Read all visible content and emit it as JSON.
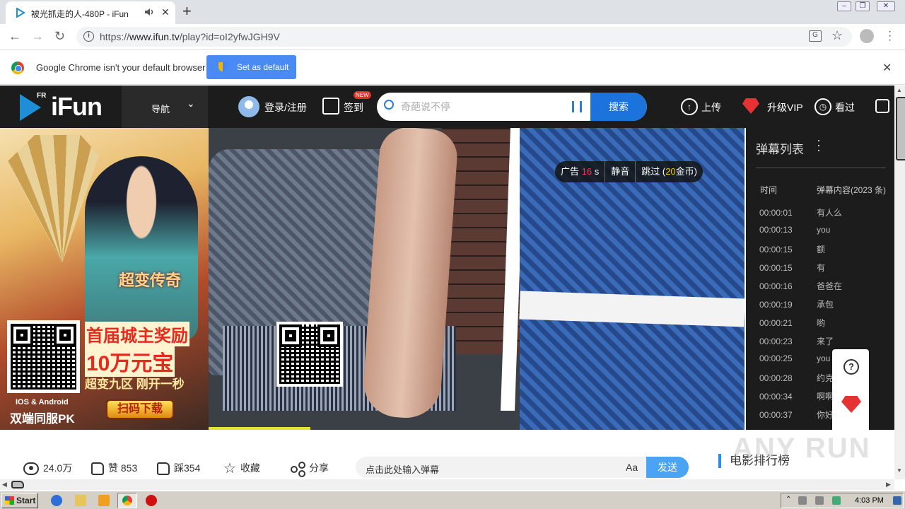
{
  "browser": {
    "tab_title": "被光抓走的人-480P - iFun",
    "new_tab": "+",
    "url_prefix": "https://",
    "url_host": "www.ifun.tv",
    "url_path": "/play?id=oI2yfwJGH9V",
    "infobar_message": "Google Chrome isn't your default browser",
    "set_default_label": "Set as default"
  },
  "site": {
    "logo_sup": "FR",
    "logo_text": "iFun",
    "nav_label": "导航",
    "login_label": "登录/注册",
    "signin_label": "签到",
    "signin_badge": "NEW",
    "search_placeholder": "奇葩说不停",
    "search_button": "搜索",
    "upload_label": "上传",
    "vip_label": "升级VIP",
    "history_label": "看过"
  },
  "ad": {
    "game_title": "超变传奇",
    "line1": "首届城主奖励",
    "line2": "10万元宝",
    "line3": "超变九区 刚开一秒",
    "platform": "IOS & Android",
    "pk": "双端同服PK",
    "download": "扫码下载"
  },
  "player": {
    "ad_prefix": "广告",
    "ad_seconds": "16",
    "ad_unit": "s",
    "mute_label": "静音",
    "skip_prefix": "跳过 (",
    "skip_coins": "20",
    "skip_suffix": "金币)",
    "progress_fraction": 0.19
  },
  "danmaku": {
    "title": "弹幕列表",
    "col_time": "时间",
    "col_content": "弹幕内容(2023 条)",
    "rows": [
      {
        "time": "00:00:01",
        "text": "有人么"
      },
      {
        "time": "00:00:13",
        "text": "you"
      },
      {
        "time": "00:00:15",
        "text": "额"
      },
      {
        "time": "00:00:15",
        "text": "有"
      },
      {
        "time": "00:00:16",
        "text": "爸爸在"
      },
      {
        "time": "00:00:19",
        "text": "承包"
      },
      {
        "time": "00:00:21",
        "text": "哟"
      },
      {
        "time": "00:00:23",
        "text": "来了"
      },
      {
        "time": "00:00:25",
        "text": "you"
      },
      {
        "time": "00:00:28",
        "text": "约克"
      },
      {
        "time": "00:00:34",
        "text": "啊啊"
      },
      {
        "time": "00:00:37",
        "text": "你好"
      }
    ]
  },
  "actions": {
    "views": "24.0万",
    "likes": "赞 853",
    "dislikes": "踩354",
    "favorite": "收藏",
    "share": "分享",
    "danmaku_placeholder": "点击此处输入弹幕",
    "font_toggle": "Aa",
    "send": "发送",
    "ranking": "电影排行榜"
  },
  "sidetools": {
    "help": "?"
  },
  "watermark": "ANY RUN",
  "taskbar": {
    "start": "Start",
    "clock": "4:03 PM"
  },
  "colors": {
    "header_bg": "#1c1c1c",
    "accent_blue": "#1c73dc",
    "progress_yellow": "#e6e232",
    "vip_red": "#e63232"
  }
}
